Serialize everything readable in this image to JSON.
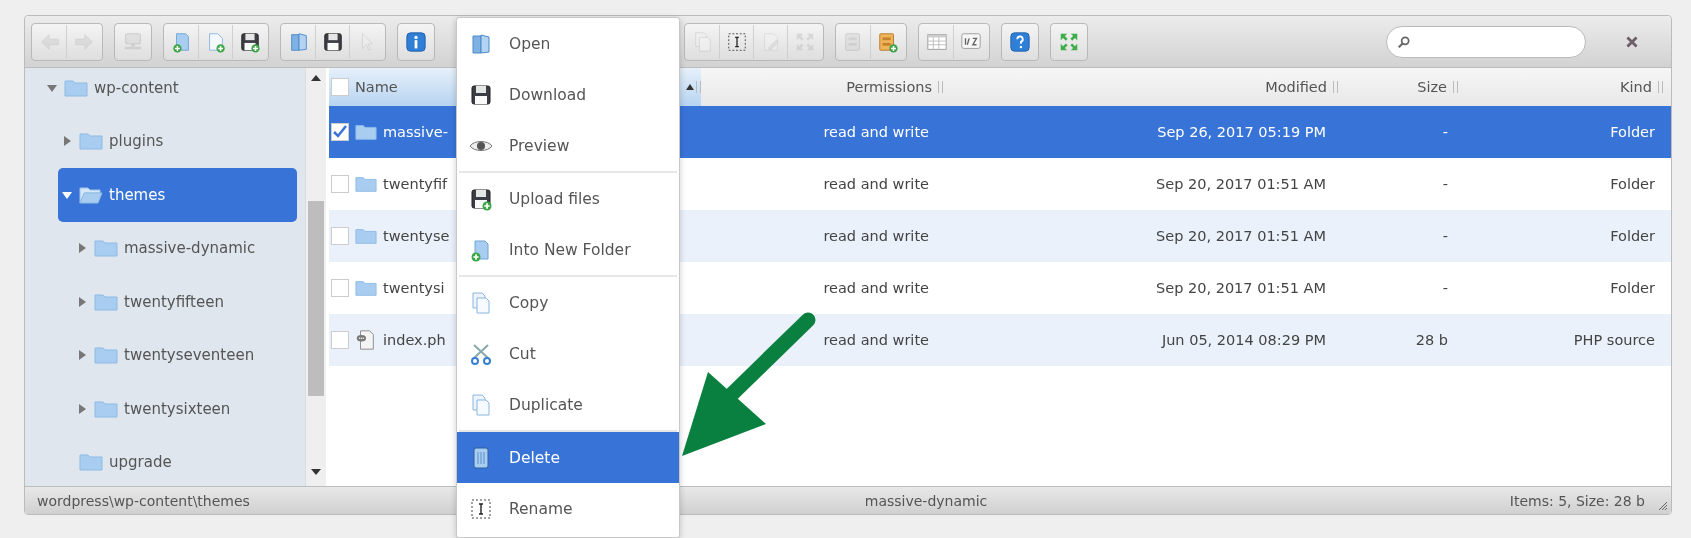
{
  "toolbar": [
    [
      {
        "kind": "back",
        "disabled": true
      },
      {
        "kind": "forward",
        "disabled": true
      }
    ],
    [
      {
        "kind": "network",
        "disabled": true
      }
    ],
    [
      {
        "kind": "new_folder",
        "disabled": false
      },
      {
        "kind": "new_file",
        "disabled": false
      },
      {
        "kind": "upload",
        "disabled": false
      }
    ],
    [
      {
        "kind": "open",
        "disabled": false
      },
      {
        "kind": "download",
        "disabled": false
      },
      {
        "kind": "select",
        "disabled": true
      }
    ],
    [
      {
        "kind": "info",
        "disabled": false
      }
    ],
    [
      {
        "kind": "duplicate",
        "disabled": true
      },
      {
        "kind": "rename",
        "disabled": false
      },
      {
        "kind": "edit",
        "disabled": true
      },
      {
        "kind": "resize",
        "disabled": true
      }
    ],
    [
      {
        "kind": "extract",
        "disabled": true
      },
      {
        "kind": "archive",
        "disabled": false
      }
    ],
    [
      {
        "kind": "view",
        "disabled": false
      },
      {
        "kind": "sort",
        "disabled": false
      }
    ],
    [
      {
        "kind": "help",
        "disabled": false
      }
    ],
    [
      {
        "kind": "fullscreen",
        "disabled": false
      }
    ]
  ],
  "tree": [
    {
      "label": "wp-content",
      "expanded": true,
      "selected": false,
      "children": [
        {
          "label": "plugins",
          "expanded": false,
          "selected": false
        },
        {
          "label": "themes",
          "expanded": true,
          "selected": true,
          "children": [
            {
              "label": "massive-dynamic",
              "expanded": false,
              "selected": false
            },
            {
              "label": "twentyfifteen",
              "expanded": false,
              "selected": false
            },
            {
              "label": "twentyseventeen",
              "expanded": false,
              "selected": false
            },
            {
              "label": "twentysixteen",
              "expanded": false,
              "selected": false
            }
          ]
        },
        {
          "label": "upgrade",
          "selected": false
        }
      ]
    }
  ],
  "table": {
    "select_all_checked": false,
    "columns": [
      {
        "label": "Name",
        "sorted": true
      },
      {
        "label": "Permissions",
        "sorted": false
      },
      {
        "label": "Modified",
        "sorted": false
      },
      {
        "label": "Size",
        "sorted": false
      },
      {
        "label": "Kind",
        "sorted": false
      }
    ],
    "rows": [
      {
        "checked": true,
        "selected": true,
        "kind": "folder",
        "name": "massive-",
        "permissions": "read and write",
        "modified": "Sep 26, 2017 05:19 PM",
        "size": "-",
        "file_type": "Folder"
      },
      {
        "checked": false,
        "selected": false,
        "kind": "folder",
        "name": "twentyfif",
        "permissions": "read and write",
        "modified": "Sep 20, 2017 01:51 AM",
        "size": "-",
        "file_type": "Folder"
      },
      {
        "checked": false,
        "selected": false,
        "kind": "folder",
        "name": "twentyse",
        "permissions": "read and write",
        "modified": "Sep 20, 2017 01:51 AM",
        "size": "-",
        "file_type": "Folder"
      },
      {
        "checked": false,
        "selected": false,
        "kind": "folder",
        "name": "twentysi",
        "permissions": "read and write",
        "modified": "Sep 20, 2017 01:51 AM",
        "size": "-",
        "file_type": "Folder"
      },
      {
        "checked": false,
        "selected": false,
        "kind": "php",
        "name": "index.ph",
        "permissions": "read and write",
        "modified": "Jun 05, 2014 08:29 PM",
        "size": "28 b",
        "file_type": "PHP source"
      }
    ]
  },
  "context_menu": {
    "groups": [
      [
        {
          "kind": "open",
          "label": "Open",
          "selected": false
        },
        {
          "kind": "download",
          "label": "Download",
          "selected": false
        },
        {
          "kind": "preview",
          "label": "Preview",
          "selected": false
        }
      ],
      [
        {
          "kind": "upload",
          "label": "Upload files",
          "selected": false
        },
        {
          "kind": "new_folder",
          "label": "Into New Folder",
          "selected": false
        }
      ],
      [
        {
          "kind": "copy",
          "label": "Copy",
          "selected": false
        },
        {
          "kind": "cut",
          "label": "Cut",
          "selected": false
        },
        {
          "kind": "duplicate",
          "label": "Duplicate",
          "selected": false
        }
      ],
      [
        {
          "kind": "delete",
          "label": "Delete",
          "selected": true
        },
        {
          "kind": "rename",
          "label": "Rename",
          "selected": false
        }
      ]
    ]
  },
  "status_bar": {
    "path": "wordpress\\wp-content\\themes",
    "selection": "massive-dynamic",
    "summary": "Items: 5, Size: 28 b"
  }
}
